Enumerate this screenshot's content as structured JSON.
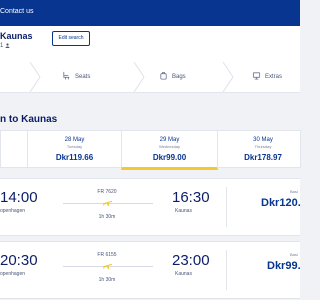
{
  "topbar": {
    "contact": "Contact us"
  },
  "search": {
    "route": "Kaunas",
    "pax": "1",
    "edit_label": "Edit search"
  },
  "steps": [
    {
      "label": "Seats",
      "icon": "seat-icon"
    },
    {
      "label": "Bags",
      "icon": "bag-icon"
    },
    {
      "label": "Extras",
      "icon": "extras-icon"
    }
  ],
  "title": "n to Kaunas",
  "dates": [
    {
      "date": "",
      "weekday": "",
      "price": ""
    },
    {
      "date": "28 May",
      "weekday": "Tuesday",
      "price": "Dkr119.66"
    },
    {
      "date": "29 May",
      "weekday": "Wednesday",
      "price": "Dkr99.00",
      "selected": true
    },
    {
      "date": "30 May",
      "weekday": "Thursday",
      "price": "Dkr178.97"
    }
  ],
  "flights": [
    {
      "dep_time": "14:00",
      "dep_city": "openhagen",
      "arr_time": "16:30",
      "arr_city": "Kaunas",
      "flight_no": "FR 7620",
      "duration": "1h 30m",
      "fare_label": "Basi",
      "price": "Dkr120."
    },
    {
      "dep_time": "20:30",
      "dep_city": "openhagen",
      "arr_time": "23:00",
      "arr_city": "Kaunas",
      "flight_no": "FR 6155",
      "duration": "1h 30m",
      "fare_label": "Basi",
      "price": "Dkr99."
    }
  ],
  "colors": {
    "brand": "#073590",
    "accent": "#f1c933",
    "background": "#f1f2f6"
  }
}
